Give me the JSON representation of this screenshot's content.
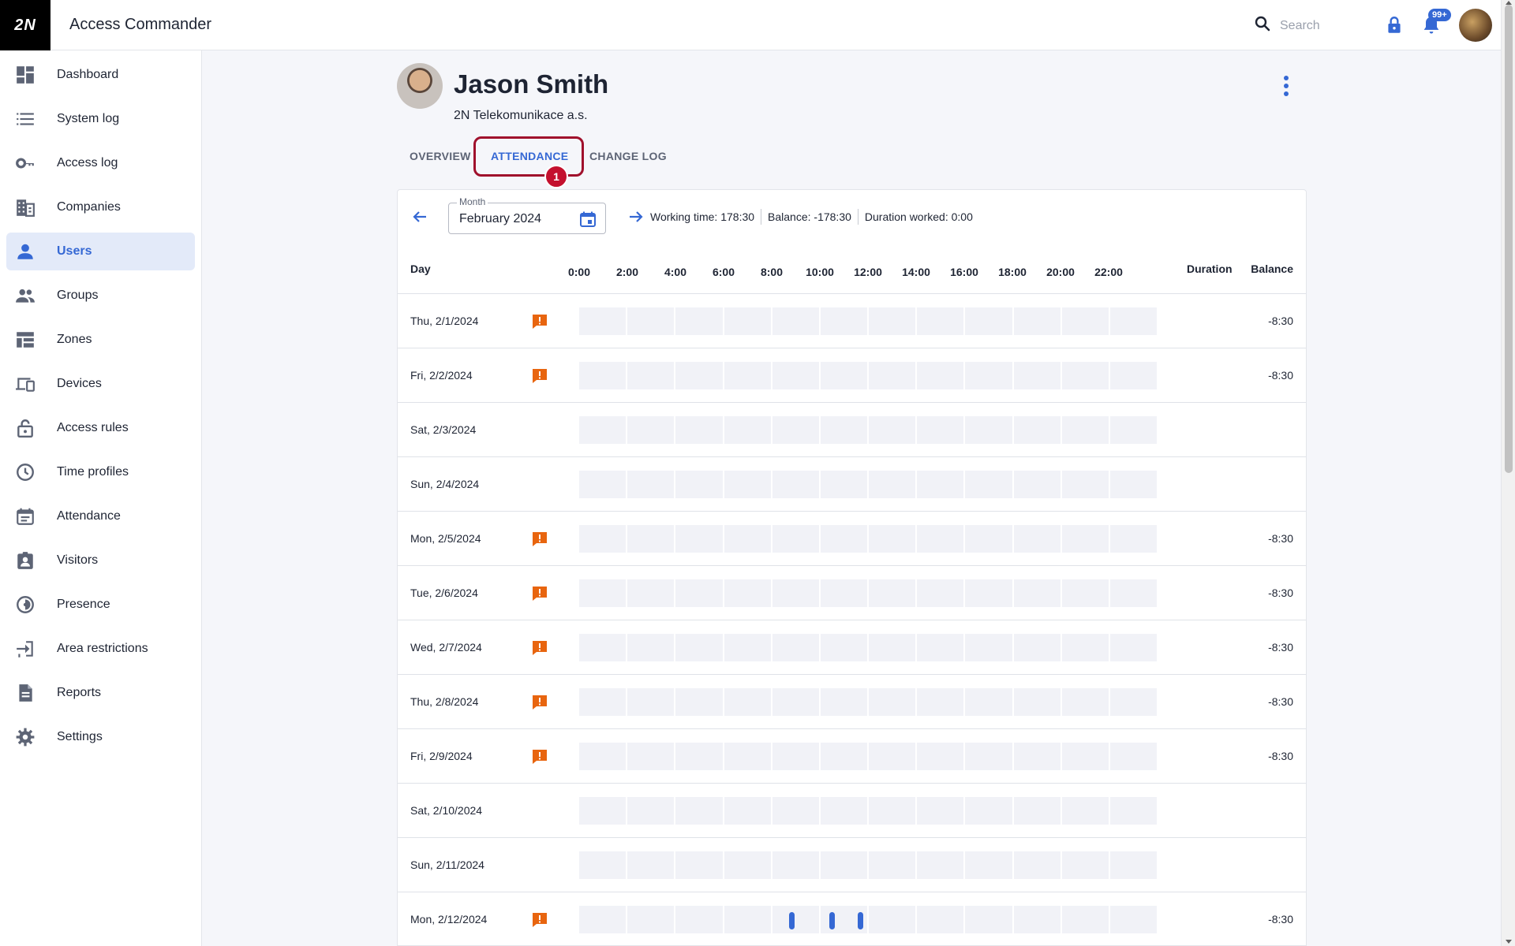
{
  "app": {
    "logo": "2N",
    "title": "Access Commander"
  },
  "header": {
    "search_placeholder": "Search",
    "notification_count": "99+"
  },
  "sidebar": {
    "items": [
      {
        "label": "Dashboard",
        "icon": "dashboard-icon"
      },
      {
        "label": "System log",
        "icon": "list-icon"
      },
      {
        "label": "Access log",
        "icon": "key-icon"
      },
      {
        "label": "Companies",
        "icon": "building-icon"
      },
      {
        "label": "Users",
        "icon": "person-icon",
        "active": true
      },
      {
        "label": "Groups",
        "icon": "group-icon"
      },
      {
        "label": "Zones",
        "icon": "zones-icon"
      },
      {
        "label": "Devices",
        "icon": "devices-icon"
      },
      {
        "label": "Access rules",
        "icon": "lock-open-icon"
      },
      {
        "label": "Time profiles",
        "icon": "clock-icon"
      },
      {
        "label": "Attendance",
        "icon": "calendar-icon"
      },
      {
        "label": "Visitors",
        "icon": "badge-icon"
      },
      {
        "label": "Presence",
        "icon": "presence-icon"
      },
      {
        "label": "Area restrictions",
        "icon": "area-restriction-icon"
      },
      {
        "label": "Reports",
        "icon": "document-icon"
      },
      {
        "label": "Settings",
        "icon": "gear-icon"
      }
    ]
  },
  "profile": {
    "name": "Jason Smith",
    "company": "2N Telekomunikace a.s."
  },
  "tabs": [
    {
      "label": "OVERVIEW"
    },
    {
      "label": "ATTENDANCE",
      "active": true
    },
    {
      "label": "CHANGE LOG"
    }
  ],
  "step_marker": "1",
  "attendance": {
    "month_label": "Month",
    "month_value": "February 2024",
    "working_time": "Working time: 178:30",
    "balance": "Balance: -178:30",
    "duration_worked": "Duration worked: 0:00",
    "columns": {
      "day": "Day",
      "duration": "Duration",
      "balance": "Balance"
    },
    "hours": [
      "0:00",
      "2:00",
      "4:00",
      "6:00",
      "8:00",
      "10:00",
      "12:00",
      "14:00",
      "16:00",
      "18:00",
      "20:00",
      "22:00"
    ],
    "rows": [
      {
        "day": "Thu, 2/1/2024",
        "warning": true,
        "balance": "-8:30"
      },
      {
        "day": "Fri, 2/2/2024",
        "warning": true,
        "balance": "-8:30"
      },
      {
        "day": "Sat, 2/3/2024",
        "warning": false,
        "balance": ""
      },
      {
        "day": "Sun, 2/4/2024",
        "warning": false,
        "balance": ""
      },
      {
        "day": "Mon, 2/5/2024",
        "warning": true,
        "balance": "-8:30"
      },
      {
        "day": "Tue, 2/6/2024",
        "warning": true,
        "balance": "-8:30"
      },
      {
        "day": "Wed, 2/7/2024",
        "warning": true,
        "balance": "-8:30"
      },
      {
        "day": "Thu, 2/8/2024",
        "warning": true,
        "balance": "-8:30"
      },
      {
        "day": "Fri, 2/9/2024",
        "warning": true,
        "balance": "-8:30"
      },
      {
        "day": "Sat, 2/10/2024",
        "warning": false,
        "balance": ""
      },
      {
        "day": "Sun, 2/11/2024",
        "warning": false,
        "balance": ""
      },
      {
        "day": "Mon, 2/12/2024",
        "warning": true,
        "balance": "-8:30",
        "events": [
          "8:50",
          "10:30",
          "11:40"
        ]
      }
    ]
  },
  "colors": {
    "accent": "#3568d4",
    "warning": "#e8650f",
    "highlight": "#a0102c"
  }
}
